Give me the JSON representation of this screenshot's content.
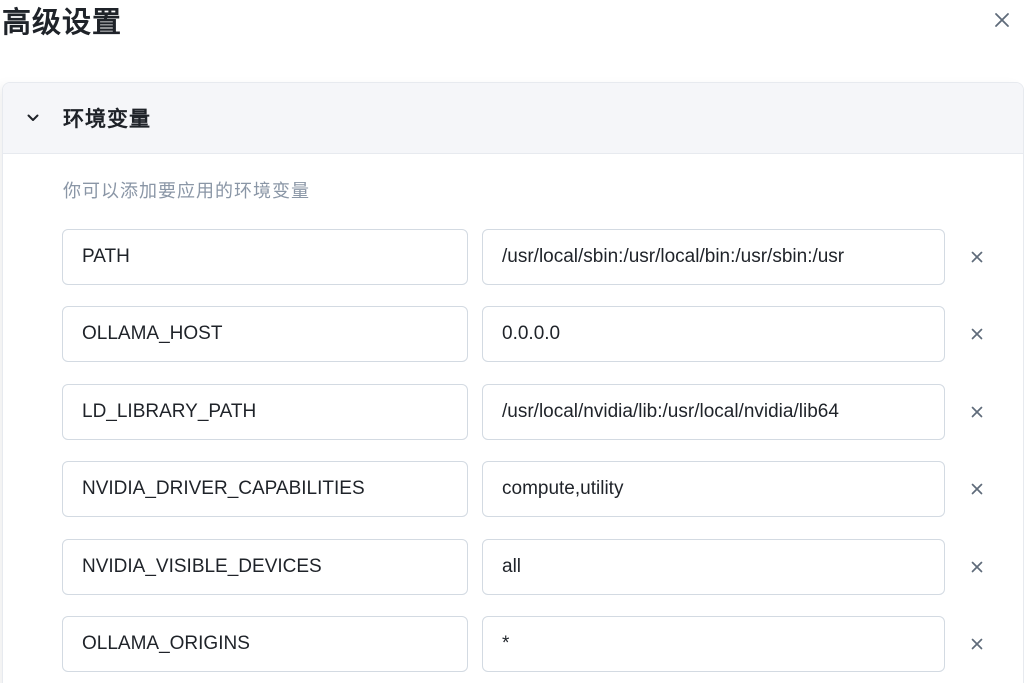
{
  "dialog": {
    "title": "高级设置",
    "close_icon": "close-icon"
  },
  "env": {
    "section_title": "环境变量",
    "expanded": true,
    "hint": "你可以添加要应用的环境变量",
    "rows": [
      {
        "key": "PATH",
        "value": "/usr/local/sbin:/usr/local/bin:/usr/sbin:/usr"
      },
      {
        "key": "OLLAMA_HOST",
        "value": "0.0.0.0"
      },
      {
        "key": "LD_LIBRARY_PATH",
        "value": "/usr/local/nvidia/lib:/usr/local/nvidia/lib64"
      },
      {
        "key": "NVIDIA_DRIVER_CAPABILITIES",
        "value": "compute,utility"
      },
      {
        "key": "NVIDIA_VISIBLE_DEVICES",
        "value": "all"
      },
      {
        "key": "OLLAMA_ORIGINS",
        "value": "*"
      }
    ]
  },
  "colors": {
    "text": "#1f2329",
    "hint": "#8a96a6",
    "header_bg": "#f5f6f9",
    "border": "#d3dae2",
    "icon": "#5f6b7a"
  }
}
